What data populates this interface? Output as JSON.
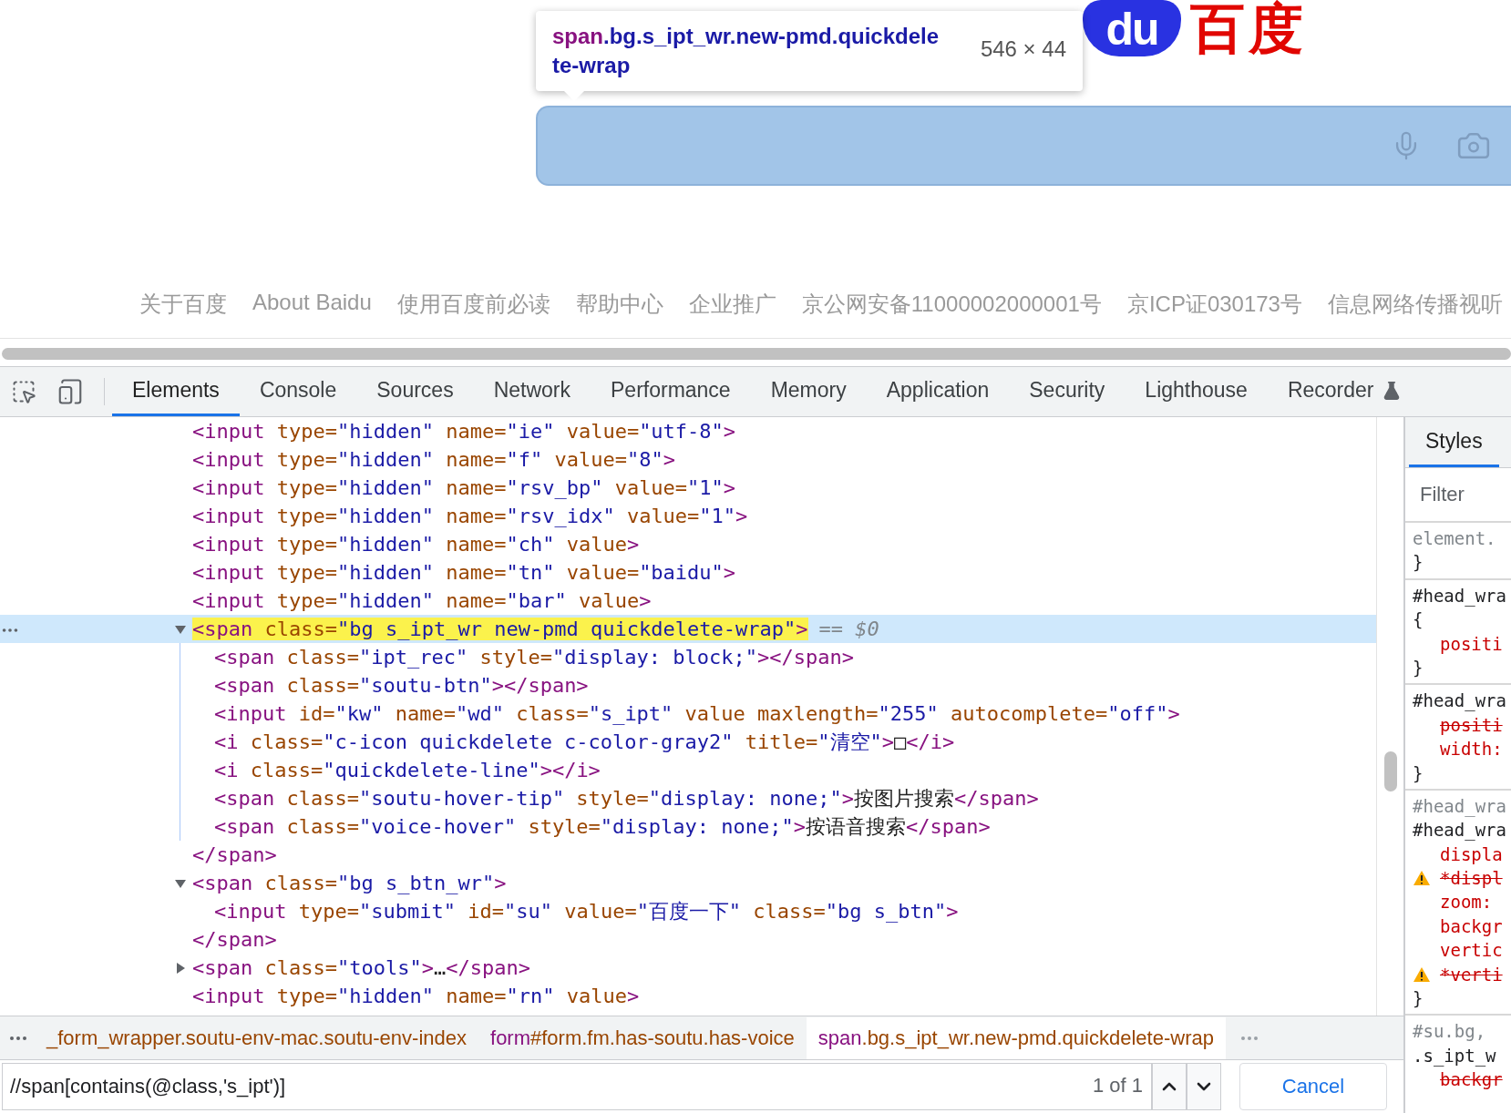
{
  "page": {
    "logo": {
      "mark": "du",
      "text": "百度"
    },
    "tooltip": {
      "tag": "span",
      "selector": ".bg.s_ipt_wr.new-pmd.quickdelete-wrap",
      "size": "546 × 44"
    },
    "footer_links": [
      "关于百度",
      "About Baidu",
      "使用百度前必读",
      "帮助中心",
      "企业推广",
      "京公网安备11000002000001号",
      "京ICP证030173号",
      "信息网络传播视听"
    ]
  },
  "devtools": {
    "tabs": [
      {
        "label": "Elements",
        "selected": true
      },
      {
        "label": "Console",
        "selected": false
      },
      {
        "label": "Sources",
        "selected": false
      },
      {
        "label": "Network",
        "selected": false
      },
      {
        "label": "Performance",
        "selected": false
      },
      {
        "label": "Memory",
        "selected": false
      },
      {
        "label": "Application",
        "selected": false
      },
      {
        "label": "Security",
        "selected": false
      },
      {
        "label": "Lighthouse",
        "selected": false
      },
      {
        "label": "Recorder",
        "selected": false
      }
    ],
    "elements": {
      "nodes": [
        {
          "line": [
            {
              "kind": "tag",
              "text": "<input"
            },
            {
              "kind": "attr",
              "text": " type="
            },
            {
              "kind": "value",
              "text": "\"hidden\""
            },
            {
              "kind": "attr",
              "text": " name="
            },
            {
              "kind": "value",
              "text": "\"ie\""
            },
            {
              "kind": "attr",
              "text": " value="
            },
            {
              "kind": "value",
              "text": "\"utf-8\""
            },
            {
              "kind": "tag",
              "text": ">"
            }
          ]
        },
        {
          "line": [
            {
              "kind": "tag",
              "text": "<input"
            },
            {
              "kind": "attr",
              "text": " type="
            },
            {
              "kind": "value",
              "text": "\"hidden\""
            },
            {
              "kind": "attr",
              "text": " name="
            },
            {
              "kind": "value",
              "text": "\"f\""
            },
            {
              "kind": "attr",
              "text": " value="
            },
            {
              "kind": "value",
              "text": "\"8\""
            },
            {
              "kind": "tag",
              "text": ">"
            }
          ]
        },
        {
          "line": [
            {
              "kind": "tag",
              "text": "<input"
            },
            {
              "kind": "attr",
              "text": " type="
            },
            {
              "kind": "value",
              "text": "\"hidden\""
            },
            {
              "kind": "attr",
              "text": " name="
            },
            {
              "kind": "value",
              "text": "\"rsv_bp\""
            },
            {
              "kind": "attr",
              "text": " value="
            },
            {
              "kind": "value",
              "text": "\"1\""
            },
            {
              "kind": "tag",
              "text": ">"
            }
          ]
        },
        {
          "line": [
            {
              "kind": "tag",
              "text": "<input"
            },
            {
              "kind": "attr",
              "text": " type="
            },
            {
              "kind": "value",
              "text": "\"hidden\""
            },
            {
              "kind": "attr",
              "text": " name="
            },
            {
              "kind": "value",
              "text": "\"rsv_idx\""
            },
            {
              "kind": "attr",
              "text": " value="
            },
            {
              "kind": "value",
              "text": "\"1\""
            },
            {
              "kind": "tag",
              "text": ">"
            }
          ]
        },
        {
          "line": [
            {
              "kind": "tag",
              "text": "<input"
            },
            {
              "kind": "attr",
              "text": " type="
            },
            {
              "kind": "value",
              "text": "\"hidden\""
            },
            {
              "kind": "attr",
              "text": " name="
            },
            {
              "kind": "value",
              "text": "\"ch\""
            },
            {
              "kind": "attr",
              "text": " value"
            },
            {
              "kind": "tag",
              "text": ">"
            }
          ]
        },
        {
          "line": [
            {
              "kind": "tag",
              "text": "<input"
            },
            {
              "kind": "attr",
              "text": " type="
            },
            {
              "kind": "value",
              "text": "\"hidden\""
            },
            {
              "kind": "attr",
              "text": " name="
            },
            {
              "kind": "value",
              "text": "\"tn\""
            },
            {
              "kind": "attr",
              "text": " value="
            },
            {
              "kind": "value",
              "text": "\"baidu\""
            },
            {
              "kind": "tag",
              "text": ">"
            }
          ]
        },
        {
          "line": [
            {
              "kind": "tag",
              "text": "<input"
            },
            {
              "kind": "attr",
              "text": " type="
            },
            {
              "kind": "value",
              "text": "\"hidden\""
            },
            {
              "kind": "attr",
              "text": " name="
            },
            {
              "kind": "value",
              "text": "\"bar\""
            },
            {
              "kind": "attr",
              "text": " value"
            },
            {
              "kind": "tag",
              "text": ">"
            }
          ]
        },
        {
          "line": [
            {
              "kind": "tag",
              "text": "<span"
            },
            {
              "kind": "attr",
              "text": " class="
            },
            {
              "kind": "value",
              "text": "\"bg s_ipt_wr new-pmd quickdelete-wrap\""
            },
            {
              "kind": "tag",
              "text": ">"
            }
          ],
          "expanded": true,
          "selected": true,
          "match": true,
          "note": "== $0",
          "children": [
            {
              "line": [
                {
                  "kind": "tag",
                  "text": "<span"
                },
                {
                  "kind": "attr",
                  "text": " class="
                },
                {
                  "kind": "value",
                  "text": "\"ipt_rec\""
                },
                {
                  "kind": "attr",
                  "text": " style="
                },
                {
                  "kind": "value",
                  "text": "\"display: block;\""
                },
                {
                  "kind": "tag",
                  "text": "></span>"
                }
              ]
            },
            {
              "line": [
                {
                  "kind": "tag",
                  "text": "<span"
                },
                {
                  "kind": "attr",
                  "text": " class="
                },
                {
                  "kind": "value",
                  "text": "\"soutu-btn\""
                },
                {
                  "kind": "tag",
                  "text": "></span>"
                }
              ]
            },
            {
              "line": [
                {
                  "kind": "tag",
                  "text": "<input"
                },
                {
                  "kind": "attr",
                  "text": " id="
                },
                {
                  "kind": "value",
                  "text": "\"kw\""
                },
                {
                  "kind": "attr",
                  "text": " name="
                },
                {
                  "kind": "value",
                  "text": "\"wd\""
                },
                {
                  "kind": "attr",
                  "text": " class="
                },
                {
                  "kind": "value",
                  "text": "\"s_ipt\""
                },
                {
                  "kind": "attr",
                  "text": " value maxlength="
                },
                {
                  "kind": "value",
                  "text": "\"255\""
                },
                {
                  "kind": "attr",
                  "text": " autocomplete="
                },
                {
                  "kind": "value",
                  "text": "\"off\""
                },
                {
                  "kind": "tag",
                  "text": ">"
                }
              ]
            },
            {
              "line": [
                {
                  "kind": "tag",
                  "text": "<i"
                },
                {
                  "kind": "attr",
                  "text": " class="
                },
                {
                  "kind": "value",
                  "text": "\"c-icon quickdelete c-color-gray2\""
                },
                {
                  "kind": "attr",
                  "text": " title="
                },
                {
                  "kind": "value",
                  "text": "\"清空\""
                },
                {
                  "kind": "tag",
                  "text": ">"
                },
                {
                  "kind": "text",
                  "text": "□"
                },
                {
                  "kind": "tag",
                  "text": "</i>"
                }
              ]
            },
            {
              "line": [
                {
                  "kind": "tag",
                  "text": "<i"
                },
                {
                  "kind": "attr",
                  "text": " class="
                },
                {
                  "kind": "value",
                  "text": "\"quickdelete-line\""
                },
                {
                  "kind": "tag",
                  "text": "></i>"
                }
              ]
            },
            {
              "line": [
                {
                  "kind": "tag",
                  "text": "<span"
                },
                {
                  "kind": "attr",
                  "text": " class="
                },
                {
                  "kind": "value",
                  "text": "\"soutu-hover-tip\""
                },
                {
                  "kind": "attr",
                  "text": " style="
                },
                {
                  "kind": "value",
                  "text": "\"display: none;\""
                },
                {
                  "kind": "tag",
                  "text": ">"
                },
                {
                  "kind": "text",
                  "text": "按图片搜索"
                },
                {
                  "kind": "tag",
                  "text": "</span>"
                }
              ]
            },
            {
              "line": [
                {
                  "kind": "tag",
                  "text": "<span"
                },
                {
                  "kind": "attr",
                  "text": " class="
                },
                {
                  "kind": "value",
                  "text": "\"voice-hover\""
                },
                {
                  "kind": "attr",
                  "text": " style="
                },
                {
                  "kind": "value",
                  "text": "\"display: none;\""
                },
                {
                  "kind": "tag",
                  "text": ">"
                },
                {
                  "kind": "text",
                  "text": "按语音搜索"
                },
                {
                  "kind": "tag",
                  "text": "</span>"
                }
              ]
            }
          ],
          "close": [
            {
              "kind": "tag",
              "text": "</span>"
            }
          ]
        },
        {
          "line": [
            {
              "kind": "tag",
              "text": "<span"
            },
            {
              "kind": "attr",
              "text": " class="
            },
            {
              "kind": "value",
              "text": "\"bg s_btn_wr\""
            },
            {
              "kind": "tag",
              "text": ">"
            }
          ],
          "expanded": true,
          "selected": false,
          "match": false,
          "children": [
            {
              "line": [
                {
                  "kind": "tag",
                  "text": "<input"
                },
                {
                  "kind": "attr",
                  "text": " type="
                },
                {
                  "kind": "value",
                  "text": "\"submit\""
                },
                {
                  "kind": "attr",
                  "text": " id="
                },
                {
                  "kind": "value",
                  "text": "\"su\""
                },
                {
                  "kind": "attr",
                  "text": " value="
                },
                {
                  "kind": "value",
                  "text": "\"百度一下\""
                },
                {
                  "kind": "attr",
                  "text": " class="
                },
                {
                  "kind": "value",
                  "text": "\"bg s_btn\""
                },
                {
                  "kind": "tag",
                  "text": ">"
                }
              ]
            }
          ],
          "close": [
            {
              "kind": "tag",
              "text": "</span>"
            }
          ]
        },
        {
          "line": [
            {
              "kind": "tag",
              "text": "<span"
            },
            {
              "kind": "attr",
              "text": " class="
            },
            {
              "kind": "value",
              "text": "\"tools\""
            },
            {
              "kind": "tag",
              "text": ">"
            },
            {
              "kind": "text",
              "text": "…"
            },
            {
              "kind": "tag",
              "text": "</span>"
            }
          ],
          "expanded": false,
          "selected": false,
          "match": false
        },
        {
          "line": [
            {
              "kind": "tag",
              "text": "<input"
            },
            {
              "kind": "attr",
              "text": " type="
            },
            {
              "kind": "value",
              "text": "\"hidden\""
            },
            {
              "kind": "attr",
              "text": " name="
            },
            {
              "kind": "value",
              "text": "\"rn\""
            },
            {
              "kind": "attr",
              "text": " value"
            },
            {
              "kind": "tag",
              "text": ">"
            }
          ]
        }
      ]
    },
    "breadcrumbs": [
      {
        "text": "_form_wrapper.soutu-env-mac.soutu-env-index",
        "selected": false
      },
      {
        "tag": "form",
        "text": "#form.fm.has-soutu.has-voice",
        "selected": false
      },
      {
        "tag": "span",
        "text": ".bg.s_ipt_wr.new-pmd.quickdelete-wrap",
        "selected": true
      }
    ],
    "search": {
      "value": "//span[contains(@class,'s_ipt')]",
      "count": "1 of 1",
      "cancel": "Cancel"
    },
    "styles": {
      "tab": {
        "label": "Styles",
        "selected": true
      },
      "filter": {
        "placeholder": "Filter"
      },
      "rules": [
        {
          "lines": [
            {
              "kind": "selector",
              "text": "element.",
              "matched": false
            },
            {
              "kind": "brace",
              "text": "}"
            }
          ]
        },
        {
          "lines": [
            {
              "kind": "selector",
              "text": "#head_wra",
              "matched": true
            },
            {
              "kind": "brace",
              "text": "{"
            },
            {
              "kind": "property",
              "text": "positi",
              "overridden": false,
              "warning": false
            },
            {
              "kind": "brace",
              "text": "}"
            }
          ]
        },
        {
          "lines": [
            {
              "kind": "selector",
              "text": "#head_wra",
              "matched": true
            },
            {
              "kind": "property",
              "text": "positi",
              "overridden": true,
              "warning": false
            },
            {
              "kind": "property",
              "text": "width:",
              "overridden": false,
              "warning": false
            },
            {
              "kind": "brace",
              "text": "}"
            }
          ]
        },
        {
          "lines": [
            {
              "kind": "selector",
              "text": "#head_wra",
              "matched": false
            },
            {
              "kind": "selector",
              "text": "#head_wra",
              "matched": true
            },
            {
              "kind": "property",
              "text": "displa",
              "overridden": false,
              "warning": false
            },
            {
              "kind": "property",
              "text": "*displ",
              "overridden": true,
              "warning": true
            },
            {
              "kind": "property",
              "text": "zoom:",
              "overridden": false,
              "warning": false
            },
            {
              "kind": "property",
              "text": "backgr",
              "overridden": false,
              "warning": false
            },
            {
              "kind": "property",
              "text": "vertic",
              "overridden": false,
              "warning": false
            },
            {
              "kind": "property",
              "text": "*verti",
              "overridden": true,
              "warning": true
            },
            {
              "kind": "brace",
              "text": "}"
            }
          ]
        },
        {
          "lines": [
            {
              "kind": "selector",
              "text": "#su.bg,",
              "matched": false
            },
            {
              "kind": "selector",
              "text": ".s_ipt_w",
              "matched": true
            },
            {
              "kind": "property",
              "text": "backgr",
              "overridden": true,
              "warning": false
            }
          ]
        }
      ]
    }
  }
}
